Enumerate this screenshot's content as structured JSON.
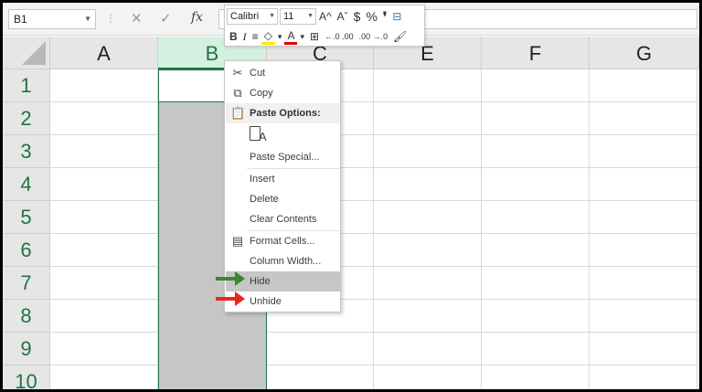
{
  "formula_bar": {
    "name_box": "B1",
    "separator": "⋮",
    "cancel_icon": "✕",
    "enter_icon": "✓",
    "fx_label": "fx"
  },
  "columns": [
    "A",
    "B",
    "C",
    "E",
    "F",
    "G"
  ],
  "rows": [
    "1",
    "2",
    "3",
    "4",
    "5",
    "6",
    "7",
    "8",
    "9",
    "10"
  ],
  "mini_toolbar": {
    "font_name": "Calibri",
    "font_size": "11",
    "grow_font": "A^",
    "shrink_font": "Aˇ",
    "currency": "$",
    "percent": "%",
    "comma": "❜",
    "bold": "B",
    "italic": "I",
    "align": "≡",
    "fill_color": "◇",
    "font_color": "A",
    "borders": "⊞",
    "inc_decimal": "←.0 .00",
    "dec_decimal": ".00 →.0",
    "format_painter": "🖌",
    "fill_color_hex": "#ffe600",
    "font_color_hex": "#e00000"
  },
  "context_menu": {
    "cut": "Cut",
    "copy": "Copy",
    "paste_options": "Paste Options:",
    "paste_special": "Paste Special...",
    "insert": "Insert",
    "delete": "Delete",
    "clear_contents": "Clear Contents",
    "format_cells": "Format Cells...",
    "column_width": "Column Width...",
    "hide": "Hide",
    "unhide": "Unhide"
  },
  "colors": {
    "excel_green": "#217346",
    "selection_gray": "#c6c6c6",
    "arrow_green": "#3b8a2e",
    "arrow_red": "#e8281e"
  }
}
